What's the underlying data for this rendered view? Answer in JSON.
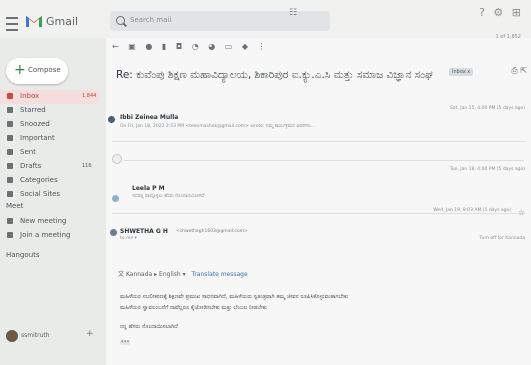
{
  "app": {
    "name": "Gmail"
  },
  "search": {
    "placeholder": "Search mail"
  },
  "compose": {
    "label": "Compose"
  },
  "sidebar": {
    "items": [
      {
        "label": "Inbox",
        "count": "1,844",
        "active": true
      },
      {
        "label": "Starred",
        "count": ""
      },
      {
        "label": "Snoozed",
        "count": ""
      },
      {
        "label": "Important",
        "count": ""
      },
      {
        "label": "Sent",
        "count": ""
      },
      {
        "label": "Drafts",
        "count": "116"
      },
      {
        "label": "Categories",
        "count": ""
      },
      {
        "label": "Social Sites",
        "count": ""
      }
    ],
    "meet_heading": "Meet",
    "meet_items": [
      "New meeting",
      "Join a meeting"
    ],
    "hangouts_heading": "Hangouts",
    "hangouts_user": "ssmitruth"
  },
  "toolbar": {
    "pagination": "1 of 1,852"
  },
  "thread": {
    "subject": "Re: ಕುವೆಂಪು ಶಿಕ್ಷಣ ಮಹಾವಿದ್ಯಾಲಯ, ಶಿಕಾರಿಪುರ ಐ.ಕ್ಯು.ಎ.ಸಿ ಮತ್ತು ಸಮಾಜ ವಿಜ್ಞಾನ ಸಂಘ",
    "label": "Inbox x"
  },
  "messages": [
    {
      "sender": "Ibbi Zeinea Mulla",
      "email": "",
      "snippet": "On Fri, Jan 18, 2022 2:53 PM <teenmashok@gmail.com> wrote: ನಿಮ್ಮ ಕಾರ್ಯಕ್ರಮದ ವಿವರಗಳು...",
      "date": "Sat, Jan 15, 4:00 PM (5 days ago)"
    },
    {
      "sender": "Leela P M",
      "email": "",
      "snippet": "ಇದರಲ್ಲಿ ಪಾಲ್ಗೊಳ್ಳಲು ಹೆಸರು ನೊಂದಾಯಿಸಲಾಗಿದೆ",
      "date": "Tue, Jan 18, 4:00 PM (5 days ago)"
    },
    {
      "sender": "SHWETHA G H",
      "email": "<shwethagh1603@gmail.com>",
      "to": "to me ▾",
      "date": "Wed, Jan 19, 8:03 AM (5 days ago)",
      "ago": "Turn off for Kannada"
    }
  ],
  "translate": {
    "from": "Kannada",
    "to": "English",
    "action": "Translate message"
  },
  "body_lines": [
    "ಮಹಿಳೆಯರ ಸಬಲೀಕರಣಕ್ಕೆ ಶಿಕ್ಷಣವೇ ಪ್ರಮುಖ ಸಾಧನವಾಗಿದೆ, ಮಹಿಳೆಯರು ಸ್ವತಂತ್ರವಾಗಿ ತಮ್ಮ ಜೀವನ ರೂಪಿಸಿಕೊಳ್ಳುವಂತಾಗಬೇಕು",
    "ಮಹಿಳೆಯರ ಸ್ವಾವಲಂಬನೆಗೆ ನಾವೆಲ್ಲರೂ ಕೈಜೋಡಿಸಬೇಕು ಮತ್ತು ಬೆಂಬಲ ನೀಡಬೇಕು",
    "ನನ್ನ ಹೆಸರು ನೊಂದಾಯಿಸಲಾಗಿದೆ"
  ]
}
